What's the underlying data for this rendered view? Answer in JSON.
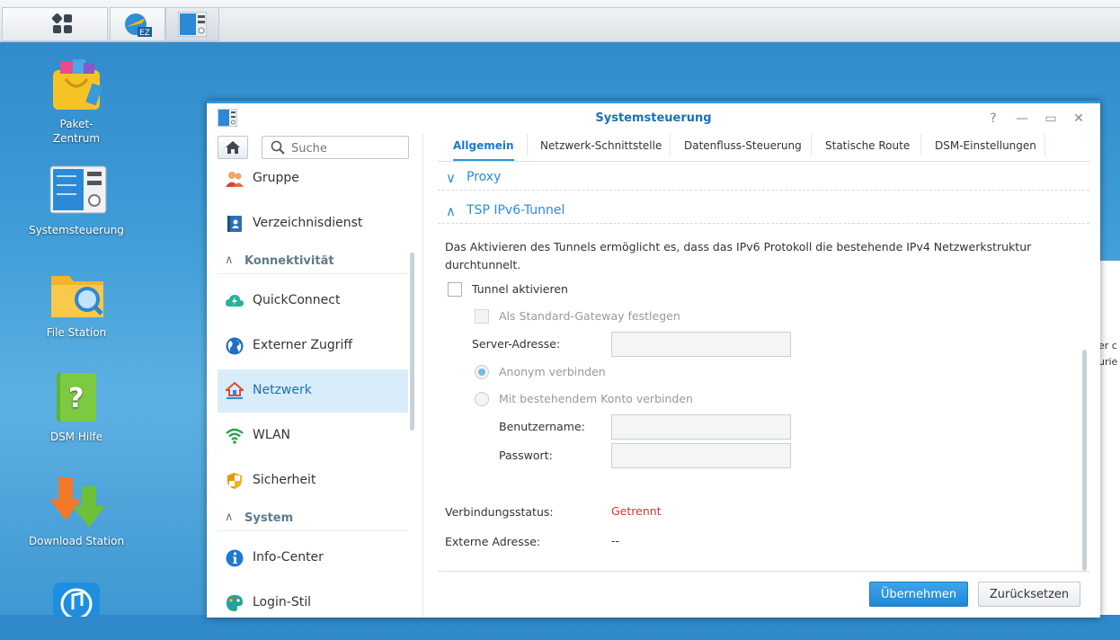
{
  "window": {
    "title": "Systemsteuerung",
    "controls": {
      "help": "?",
      "minimize": "—",
      "maximize": "▭",
      "close": "✕"
    }
  },
  "desktop": {
    "icons": [
      {
        "label": "Paket-\nZentrum"
      },
      {
        "label": "Systemsteuerung"
      },
      {
        "label": "File Station"
      },
      {
        "label": "DSM Hilfe"
      },
      {
        "label": "Download Station"
      }
    ]
  },
  "taskbar": {
    "ez_badge": "EZ"
  },
  "sidebar": {
    "search_placeholder": "Suche",
    "items": {
      "gruppe": "Gruppe",
      "verzeichnisdienst": "Verzeichnisdienst",
      "quickconnect": "QuickConnect",
      "externer_zugriff": "Externer Zugriff",
      "netzwerk": "Netzwerk",
      "wlan": "WLAN",
      "sicherheit": "Sicherheit",
      "info_center": "Info-Center",
      "login_stil": "Login-Stil"
    },
    "sections": {
      "konnektivitaet": "Konnektivität",
      "system": "System"
    }
  },
  "tabs": {
    "allgemein": "Allgemein",
    "netzwerk_schnittstelle": "Netzwerk-Schnittstelle",
    "datenfluss": "Datenfluss-Steuerung",
    "statische_route": "Statische Route",
    "dsm_einstellungen": "DSM-Einstellungen"
  },
  "sections": {
    "proxy": "Proxy",
    "tsp": "TSP IPv6-Tunnel"
  },
  "tsp": {
    "description": "Das Aktivieren des Tunnels ermöglicht es, dass das IPv6 Protokoll die bestehende IPv4 Netzwerkstruktur durchtunnelt.",
    "tunnel_aktivieren": "Tunnel aktivieren",
    "standard_gateway": "Als Standard-Gateway festlegen",
    "server_adresse_label": "Server-Adresse:",
    "anonym": "Anonym verbinden",
    "konto": "Mit bestehendem Konto verbinden",
    "benutzername_label": "Benutzername:",
    "passwort_label": "Passwort:",
    "verbindungsstatus_label": "Verbindungsstatus:",
    "verbindungsstatus_value": "Getrennt",
    "externe_adresse_label": "Externe Adresse:",
    "externe_adresse_value": "--"
  },
  "buttons": {
    "apply": "Übernehmen",
    "reset": "Zurücksetzen"
  },
  "background_text": {
    "line1": "er c",
    "line2": "urie"
  }
}
